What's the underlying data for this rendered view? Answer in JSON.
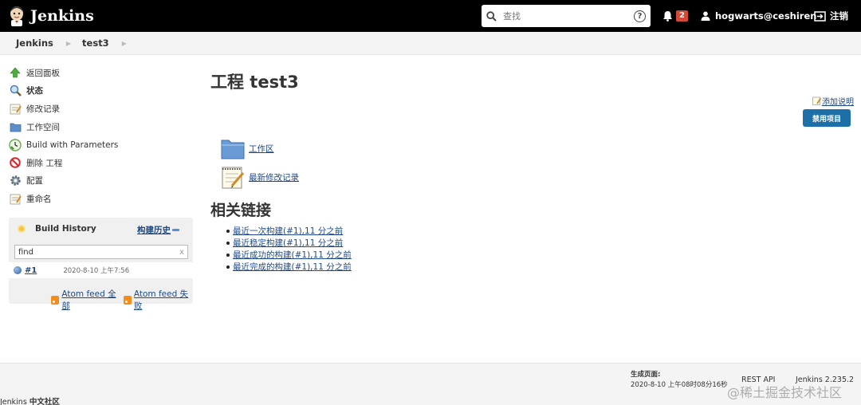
{
  "header": {
    "brand": "Jenkins",
    "search_placeholder": "查找",
    "help": "?",
    "notification_count": "2",
    "user": "hogwarts@ceshiren",
    "logout": "注销"
  },
  "breadcrumb": [
    "Jenkins",
    "test3"
  ],
  "tasks": [
    {
      "label": "返回面板",
      "icon": "up-arrow-icon"
    },
    {
      "label": "状态",
      "icon": "search-icon",
      "bold": true
    },
    {
      "label": "修改记录",
      "icon": "notepad-icon"
    },
    {
      "label": "工作空间",
      "icon": "folder-icon"
    },
    {
      "label": "Build with Parameters",
      "icon": "clock-icon"
    },
    {
      "label": "删除 工程",
      "icon": "no-entry-icon"
    },
    {
      "label": "配置",
      "icon": "gear-icon"
    },
    {
      "label": "重命名",
      "icon": "notepad-icon"
    }
  ],
  "build_history": {
    "title": "Build History",
    "link": "构建历史",
    "filter_value": "find",
    "filter_clear": "x",
    "builds": [
      {
        "number": "#1",
        "time": "2020-8-10 上午7:56"
      }
    ],
    "feed_all": "Atom feed 全部",
    "feed_fail": "Atom feed 失败"
  },
  "main": {
    "title": "工程 test3",
    "add_description": "添加说明",
    "disable_button": "禁用项目",
    "links": [
      "工作区",
      "最新修改记录"
    ],
    "related_title": "相关链接",
    "related": [
      "最近一次构建(#1),11 分之前",
      "最近稳定构建(#1),11 分之前",
      "最近成功的构建(#1),11 分之前",
      "最近完成的构建(#1),11 分之前"
    ]
  },
  "footer": {
    "generated_label": "生成页面:",
    "generated_time": "2020-8-10 上午08时08分16秒",
    "rest_api": "REST API",
    "version": "Jenkins 2.235.2",
    "community_prefix": "Jenkins",
    "community_suffix": "中文社区"
  },
  "watermark": "@稀土掘金技术社区"
}
